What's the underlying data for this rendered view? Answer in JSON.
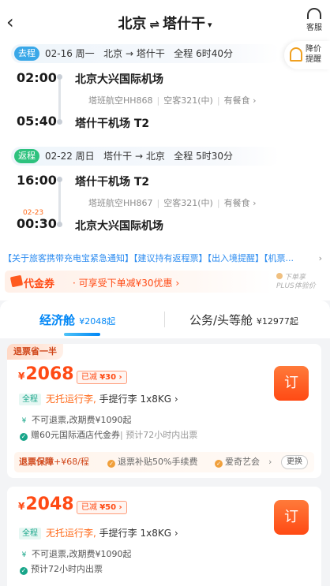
{
  "header": {
    "back_icon": "chevron-left-icon",
    "origin": "北京",
    "swap_glyph": "⇌",
    "destination": "塔什干",
    "caret": "▾",
    "service_label": "客服"
  },
  "price_alert": {
    "label": "降价提醒",
    "icon": "bell-icon"
  },
  "outbound": {
    "tag": "去程",
    "date": "02-16 周一",
    "route": "北京 → 塔什干",
    "duration": "全程 6时40分",
    "depart_time": "02:00",
    "depart_airport": "北京大兴国际机场",
    "airline_flight": "塔班航空HH868",
    "aircraft": "空客321(中)",
    "meal": "有餐食",
    "arrive_time": "05:40",
    "arrive_airport": "塔什干机场 T2"
  },
  "return": {
    "tag": "返程",
    "date": "02-22 周日",
    "route": "塔什干 → 北京",
    "duration": "全程 5时30分",
    "depart_time": "16:00",
    "depart_airport": "塔什干机场 T2",
    "airline_flight": "塔班航空HH867",
    "aircraft": "空客321(中)",
    "meal": "有餐食",
    "arrive_date": "02-23",
    "arrive_time": "00:30",
    "arrive_airport": "北京大兴国际机场"
  },
  "notices": {
    "text": "【关于旅客携带充电宝紧急通知】【建议持有返程票】【出入境提醒】【机票...",
    "chevron": "›"
  },
  "coupon": {
    "title": "代金券",
    "desc": "· 可享受下单减¥30优惠 ›"
  },
  "plus_promo": {
    "line1": "下单享",
    "line2": "PLUS体验价"
  },
  "tabs": [
    {
      "label": "经济舱",
      "price": "¥2048起"
    },
    {
      "label": "公务/头等舱",
      "price": "¥12977起"
    }
  ],
  "offers": [
    {
      "ribbon": "退票省一半",
      "currency": "¥",
      "price": "2068",
      "discount_prefix": "已减",
      "discount_value": "¥30 ›",
      "book_label": "订",
      "scope": "全程",
      "baggage_free": "无托运行李,",
      "baggage_carry": "手提行李 1x8KG ›",
      "refund_icon": "¥",
      "refund": "不可退票,改期费¥1090起",
      "gift": "赠60元国际酒店代金券",
      "gift_note": "| 预计72小时内出票",
      "protect_title": "退票保障",
      "protect_price": "+¥68/程",
      "protect_item1": "退票补贴50%手续费",
      "protect_item2": "爱奇艺会",
      "protect_chevron": "›",
      "protect_change": "更换"
    },
    {
      "currency": "¥",
      "price": "2048",
      "discount_prefix": "已减",
      "discount_value": "¥50 ›",
      "book_label": "订",
      "scope": "全程",
      "baggage_free": "无托运行李,",
      "baggage_carry": "手提行李 1x8KG ›",
      "refund_icon": "¥",
      "refund": "不可退票,改期费¥1090起",
      "ticketing": "预计72小时内出票"
    }
  ],
  "colors": {
    "accent_blue": "#0086f6",
    "price_orange": "#ff4a14",
    "outbound_tag": "#3aa8e8",
    "return_tag": "#2ec27e"
  }
}
